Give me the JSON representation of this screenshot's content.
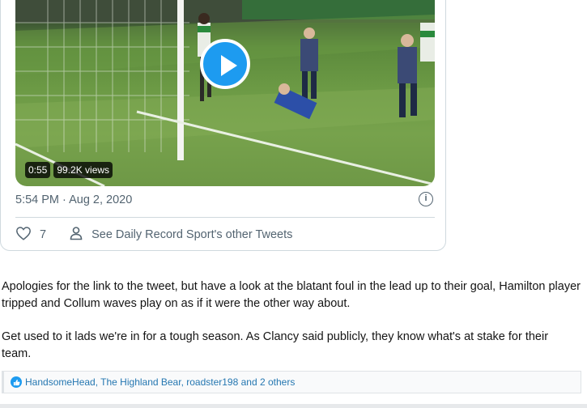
{
  "tweet": {
    "video": {
      "duration": "0:55",
      "views": "99.2K views"
    },
    "timestamp": "5:54 PM · Aug 2, 2020",
    "likes": "7",
    "other_tweets_label": "See Daily Record Sport's other Tweets"
  },
  "post": {
    "paragraphs": [
      "Apologies for the link to the tweet, but have a look at the blatant foul in the lead up to their goal, Hamilton player tripped and Collum waves play on as if it were the other way about.",
      "Get used to it lads we're in for a tough season. As Clancy said publicly, they know what's at stake for their team."
    ]
  },
  "reactions": {
    "text": "HandsomeHead, The Highland Bear, roadster198 and 2 others"
  },
  "colors": {
    "accent": "#1d9bf0",
    "muted": "#536471",
    "link": "#2577b1"
  }
}
